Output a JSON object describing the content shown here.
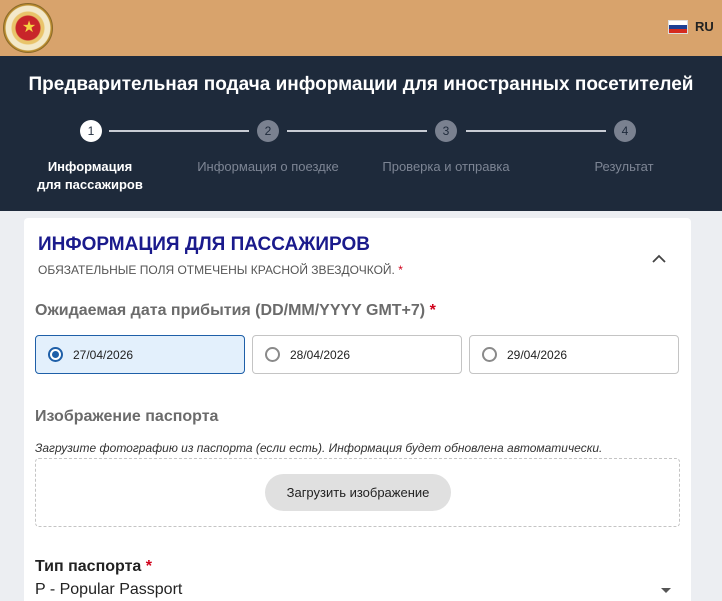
{
  "header": {
    "logo_icon": "immigration-emblem-icon",
    "language": {
      "flag_icon": "russia-flag-icon",
      "code": "RU",
      "flag_colors": [
        "#ffffff",
        "#1c3f94",
        "#d52b1e"
      ]
    }
  },
  "hero": {
    "title": "Предварительная подача информации для иностранных посетителей",
    "steps": [
      {
        "number": "1",
        "label": "Информация для пассажиров",
        "active": true
      },
      {
        "number": "2",
        "label": "Информация о поездке",
        "active": false
      },
      {
        "number": "3",
        "label": "Проверка и отправка",
        "active": false
      },
      {
        "number": "4",
        "label": "Результат",
        "active": false
      }
    ]
  },
  "form": {
    "section_title": "ИНФОРМАЦИЯ ДЛЯ ПАССАЖИРОВ",
    "section_subtitle": "ОБЯЗАТЕЛЬНЫЕ ПОЛЯ ОТМЕЧЕНЫ КРАСНОЙ ЗВЕЗДОЧКОЙ.",
    "required_mark": "*",
    "collapse_icon": "chevron-up-icon",
    "arrival": {
      "label": "Ожидаемая дата прибытия (DD/MM/YYYY GMT+7)",
      "options": [
        "27/04/2026",
        "28/04/2026",
        "29/04/2026"
      ],
      "selected": "27/04/2026"
    },
    "passport_image": {
      "label": "Изображение паспорта",
      "hint": "Загрузите фотографию из паспорта (если есть). Информация будет обновлена автоматически.",
      "upload_label": "Загрузить изображение"
    },
    "passport_type": {
      "label": "Тип паспорта",
      "value": "P - Popular Passport"
    }
  },
  "colors": {
    "topbar": "#d8a36c",
    "hero": "#1e2a3b",
    "accent": "#1e5fa8",
    "title": "#1a1a8c",
    "required": "#d0021b"
  }
}
